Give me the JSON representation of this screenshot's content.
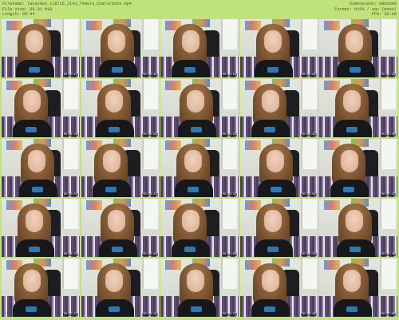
{
  "header": {
    "filename_line": "Filename: lacey8ee_118716_2143_female_Chaturbate.mp4",
    "filesize_line": "File size: 68.01 MiB",
    "length_line": "Length: 05:44",
    "dimensions_line": "Dimensions: 880x660",
    "format_line": "Format: h264 / aac (mono)",
    "fps_line": "FPS: 30.00"
  },
  "thumbnails": [
    {
      "label": "00:00:17"
    },
    {
      "label": "00:00:34"
    },
    {
      "label": "00:00:51"
    },
    {
      "label": "00:01:08"
    },
    {
      "label": "00:01:25"
    },
    {
      "label": "00:01:42"
    },
    {
      "label": "00:01:59"
    },
    {
      "label": "00:02:16"
    },
    {
      "label": "00:02:33"
    },
    {
      "label": "00:02:50"
    },
    {
      "label": "00:03:07"
    },
    {
      "label": "00:03:24"
    },
    {
      "label": "00:03:41"
    },
    {
      "label": "00:03:58"
    },
    {
      "label": "00:04:15"
    },
    {
      "label": "00:04:32"
    },
    {
      "label": "00:04:49"
    },
    {
      "label": "00:05:06"
    },
    {
      "label": "00:05:23"
    },
    {
      "label": "00:05:40"
    },
    {
      "label": "00:05:57"
    },
    {
      "label": "00:06:14"
    },
    {
      "label": "00:06:31"
    },
    {
      "label": "00:06:48"
    },
    {
      "label": "00:07:05"
    }
  ]
}
